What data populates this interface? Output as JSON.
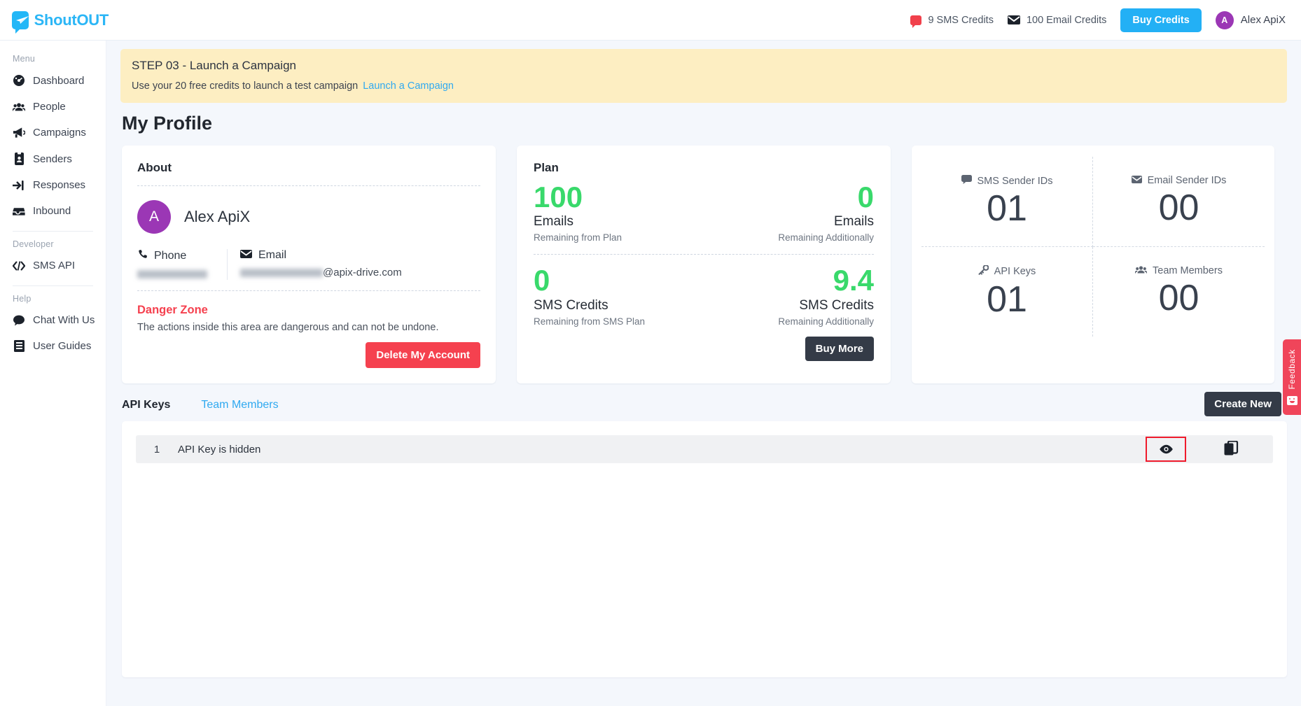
{
  "brand": {
    "name": "ShoutOUT",
    "accent": "#2bb6f6",
    "logo_icon": "paper-plane-bubble-icon"
  },
  "topbar": {
    "sms_credits": "9 SMS Credits",
    "email_credits": "100 Email Credits",
    "buy_credits_label": "Buy Credits",
    "user_initial": "A",
    "user_name": "Alex ApiX"
  },
  "sidebar": {
    "menu_heading": "Menu",
    "menu_items": [
      {
        "label": "Dashboard",
        "icon": "dashboard-icon"
      },
      {
        "label": "People",
        "icon": "people-icon"
      },
      {
        "label": "Campaigns",
        "icon": "megaphone-icon"
      },
      {
        "label": "Senders",
        "icon": "id-card-icon"
      },
      {
        "label": "Responses",
        "icon": "sign-in-arrow-icon"
      },
      {
        "label": "Inbound",
        "icon": "inbox-icon"
      }
    ],
    "developer_heading": "Developer",
    "developer_items": [
      {
        "label": "SMS API",
        "icon": "code-icon"
      }
    ],
    "help_heading": "Help",
    "help_items": [
      {
        "label": "Chat With Us",
        "icon": "chat-bubble-icon"
      },
      {
        "label": "User Guides",
        "icon": "book-icon"
      }
    ]
  },
  "banner": {
    "title": "STEP 03 - Launch a Campaign",
    "text": "Use your 20 free credits to launch a test campaign",
    "link": "Launch a Campaign",
    "bg": "#fdeec2"
  },
  "page": {
    "title": "My Profile"
  },
  "about": {
    "heading": "About",
    "avatar_initial": "A",
    "name": "Alex ApiX",
    "phone_label": "Phone",
    "phone_value": "",
    "email_label": "Email",
    "email_value_masked": "@apix-drive.com",
    "danger_title": "Danger Zone",
    "danger_text": "The actions inside this area are dangerous and can not be undone.",
    "delete_label": "Delete My Account",
    "danger_color": "#f5414f"
  },
  "plan": {
    "heading": "Plan",
    "green": "#39d96b",
    "cells": [
      {
        "number": "100",
        "unit": "Emails",
        "sub": "Remaining from Plan",
        "align": "left"
      },
      {
        "number": "0",
        "unit": "Emails",
        "sub": "Remaining Additionally",
        "align": "right"
      },
      {
        "number": "0",
        "unit": "SMS Credits",
        "sub": "Remaining from SMS Plan",
        "align": "left"
      },
      {
        "number": "9.4",
        "unit": "SMS Credits",
        "sub": "Remaining Additionally",
        "align": "right"
      }
    ],
    "buy_more_label": "Buy More"
  },
  "stats": [
    {
      "label": "SMS Sender IDs",
      "value": "01",
      "icon": "chat-bubble-icon"
    },
    {
      "label": "Email Sender IDs",
      "value": "00",
      "icon": "envelope-icon"
    },
    {
      "label": "API Keys",
      "value": "01",
      "icon": "key-icon"
    },
    {
      "label": "Team Members",
      "value": "00",
      "icon": "users-icon"
    }
  ],
  "keys_panel": {
    "tab_active": "API Keys",
    "tab_inactive": "Team Members",
    "create_new_label": "Create New",
    "rows": [
      {
        "index": "1",
        "text": "API Key is hidden",
        "view_icon": "eye-icon",
        "copy_icon": "copy-icon"
      }
    ]
  },
  "feedback": {
    "label": "Feedback",
    "icon": "smiley-face-icon",
    "color": "#f0455a"
  }
}
